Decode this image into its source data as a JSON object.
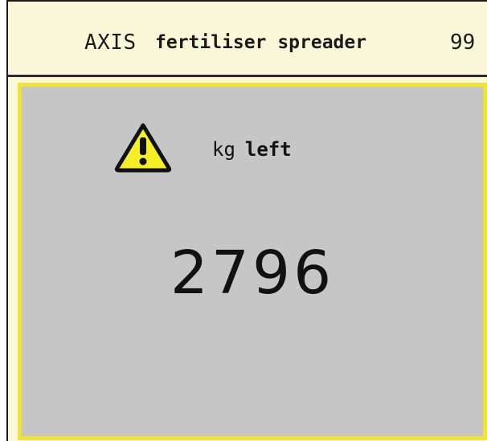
{
  "header": {
    "brand": "AXIS",
    "title": "fertiliser spreader",
    "code": "99"
  },
  "alarm": {
    "icon": "warning-icon",
    "unit": "kg",
    "message": "left",
    "value": "2796"
  },
  "colors": {
    "header_bg": "#fbf8da",
    "panel_bg": "#c6c6c6",
    "frame": "#efe33a",
    "warning_fill": "#f5ef2a"
  }
}
